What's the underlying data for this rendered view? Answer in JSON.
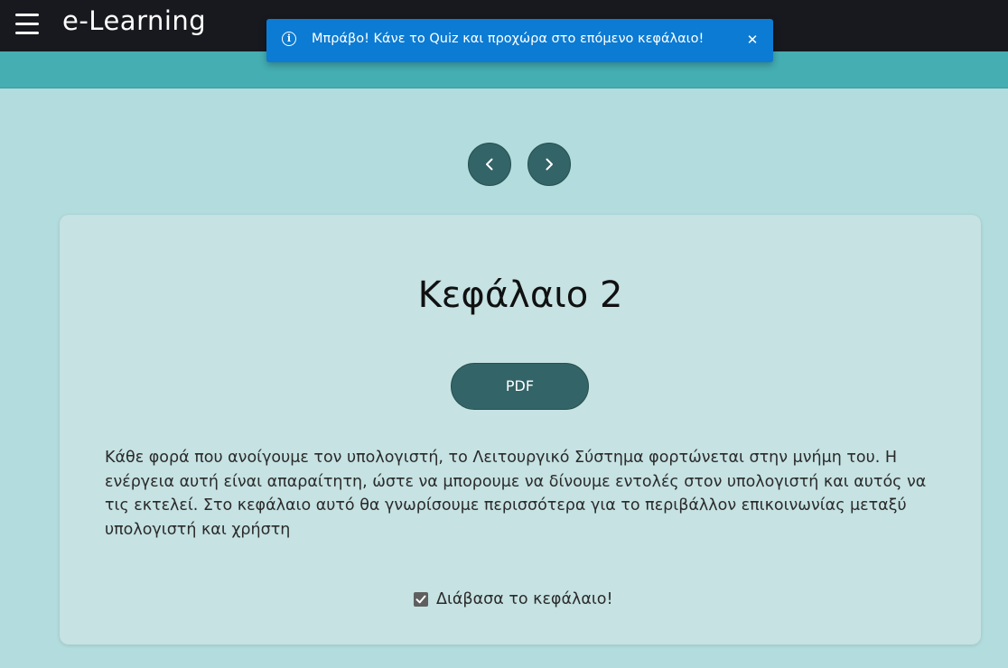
{
  "app": {
    "title": "e-Learning",
    "menu_icon": "hamburger-menu-icon"
  },
  "toast": {
    "icon": "info-icon",
    "message": "Μπράβο! Κάνε το Quiz και προχώρα στο επόμενο κεφάλαιο!",
    "close_icon": "close-icon",
    "color": "#0c7bd3"
  },
  "navigation": {
    "prev_icon": "chevron-left-icon",
    "next_icon": "chevron-right-icon"
  },
  "chapter": {
    "title": "Κεφάλαιο 2",
    "pdf_label": "PDF",
    "text": "Κάθε φορά που ανοίγουμε τον υπολογιστή, το Λειτουργικό Σύστημα φορτώνεται στην μνήμη του. Η ενέργεια αυτή είναι απαραίτητη, ώστε να μπορουμε να δίνουμε εντολές στον υπολογιστή και αυτός να τις εκτελεί. Στο κεφάλαιο αυτό θα γνωρίσουμε περισσότερα για το περιβάλλον επικοινωνίας μεταξύ υπολογιστή και χρήστη",
    "read_label": "Διάβασα το κεφάλαιο!",
    "read_checked": true
  },
  "colors": {
    "topbar": "#17191e",
    "subbar": "#44aeb3",
    "background": "#b2dcdd",
    "card": "#c6e2e3",
    "button": "#336467"
  }
}
